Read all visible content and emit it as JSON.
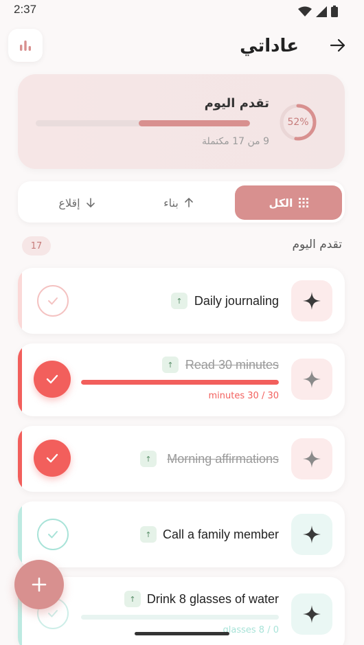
{
  "status": {
    "time": "2:37"
  },
  "header": {
    "title": "عاداتي",
    "stats_icon": "bar-chart-icon",
    "back_icon": "arrow-right-icon"
  },
  "progress": {
    "title": "تقدم اليوم",
    "percent_label": "52%",
    "fraction": 0.52,
    "summary": "9 من 17 مكتملة",
    "accent": "#d8908f"
  },
  "filters": {
    "all": "الكل",
    "build": "بناء",
    "quit": "إقلاع"
  },
  "section": {
    "title": "تقدم اليوم",
    "count": "17"
  },
  "habits": [
    {
      "title": "Daily journaling",
      "tag": "↑",
      "done": false,
      "color": "#f4b9b8",
      "icon_bg": "#fcebeb",
      "icon_color": "#3a3a3a"
    },
    {
      "title": "Read 30 minutes",
      "tag": "↑",
      "done": true,
      "color": "#f25f5c",
      "icon_bg": "#fcebeb",
      "icon_color": "#8a8a8a",
      "progress_text": "minutes 30 / 30",
      "progress": 1.0
    },
    {
      "title": "Morning affirmations",
      "tag": "↑",
      "done": true,
      "color": "#f25f5c",
      "icon_bg": "#fcebeb",
      "icon_color": "#8a8a8a"
    },
    {
      "title": "Call a family member",
      "tag": "↑",
      "done": false,
      "color": "#a8e3d8",
      "icon_bg": "#eaf7f4",
      "icon_color": "#3a3a3a"
    },
    {
      "title": "Drink 8 glasses of water",
      "tag": "↑",
      "done": false,
      "color": "#a8e3d8",
      "icon_bg": "#eaf7f4",
      "icon_color": "#3a3a3a",
      "progress_text": "glasses 8 / 0",
      "progress": 0.0
    }
  ],
  "fab": {
    "icon": "plus-icon"
  }
}
